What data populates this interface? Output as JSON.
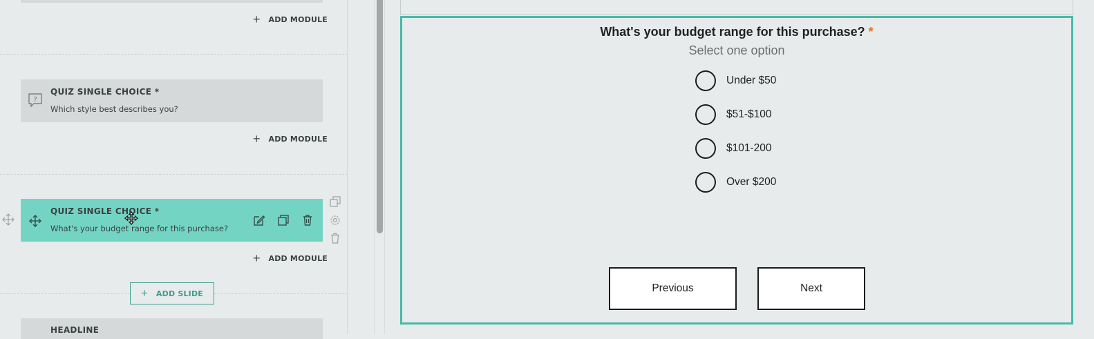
{
  "editor": {
    "add_module_label": "ADD MODULE",
    "add_slide_label": "ADD SLIDE",
    "modules": [
      {
        "title": "QUIZ SINGLE CHOICE *",
        "subtitle": "Which style best describes you?",
        "icon": "question-bubble-icon"
      },
      {
        "title": "QUIZ SINGLE CHOICE *",
        "subtitle": "What's your budget range for this purchase?",
        "icon": "move-icon",
        "active": true
      },
      {
        "title": "HEADLINE",
        "subtitle": ""
      }
    ]
  },
  "preview": {
    "question": "What's your budget range for this purchase?",
    "required_marker": "*",
    "subtitle": "Select one option",
    "options": [
      "Under $50",
      "$51-$100",
      "$101-200",
      "Over $200"
    ],
    "previous_label": "Previous",
    "next_label": "Next"
  },
  "colors": {
    "accent": "#44bba9",
    "active_card": "#74d4c4",
    "required": "#e8702a"
  }
}
